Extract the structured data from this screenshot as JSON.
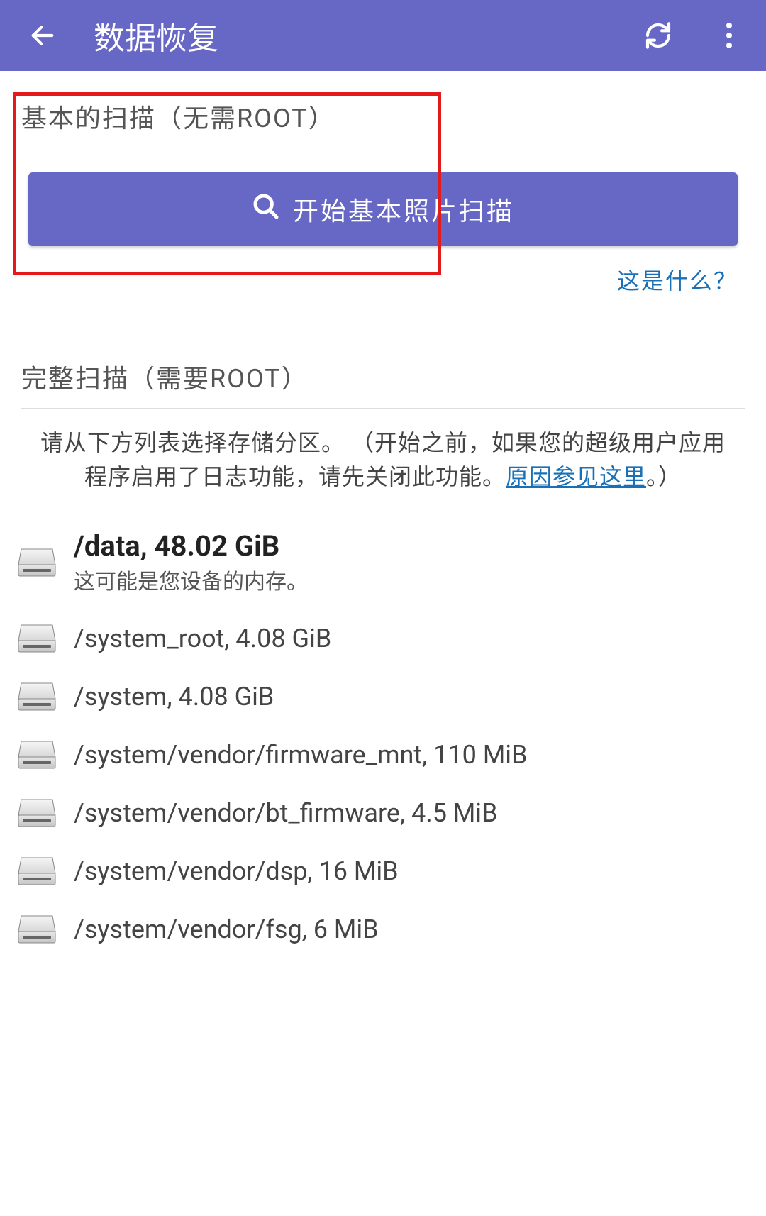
{
  "appbar": {
    "title": "数据恢复"
  },
  "basic_scan": {
    "title": "基本的扫描（无需ROOT）",
    "button_label": "开始基本照片扫描",
    "help_link": "这是什么？"
  },
  "full_scan": {
    "title": "完整扫描（需要ROOT）",
    "instruction_prefix": "请从下方列表选择存储分区。 （开始之前，如果您的超级用户应用程序启用了日志功能，请先关闭此功能。",
    "instruction_link": "原因参见这里",
    "instruction_suffix": "。）"
  },
  "partitions": [
    {
      "title": "/data, 48.02 GiB",
      "subtitle": "这可能是您设备的内存。",
      "bold": true
    },
    {
      "title": "/system_root, 4.08 GiB",
      "subtitle": "",
      "bold": false
    },
    {
      "title": "/system, 4.08 GiB",
      "subtitle": "",
      "bold": false
    },
    {
      "title": "/system/vendor/firmware_mnt, 110 MiB",
      "subtitle": "",
      "bold": false
    },
    {
      "title": "/system/vendor/bt_firmware, 4.5 MiB",
      "subtitle": "",
      "bold": false
    },
    {
      "title": "/system/vendor/dsp, 16 MiB",
      "subtitle": "",
      "bold": false
    },
    {
      "title": "/system/vendor/fsg, 6 MiB",
      "subtitle": "",
      "bold": false
    }
  ]
}
